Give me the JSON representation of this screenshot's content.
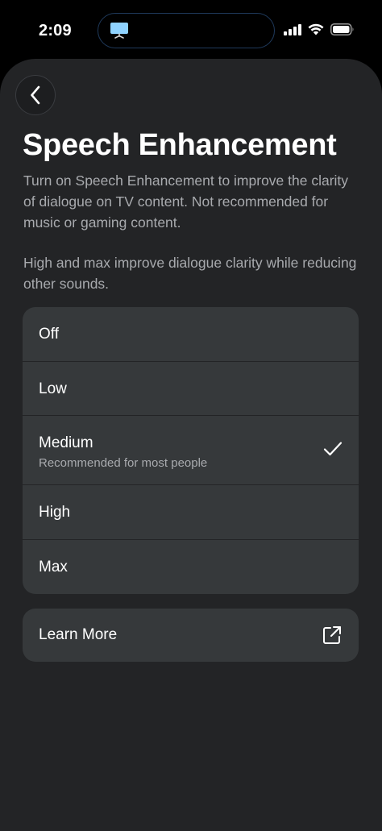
{
  "status_bar": {
    "time": "2:09"
  },
  "page": {
    "title": "Speech Enhancement",
    "description_1": "Turn on Speech Enhancement to improve the clarity of dialogue on TV content. Not recommended for music or gaming content.",
    "description_2": "High and max improve dialogue clarity while reducing other sounds."
  },
  "options": [
    {
      "label": "Off"
    },
    {
      "label": "Low"
    },
    {
      "label": "Medium",
      "sublabel": "Recommended for most people",
      "selected": true
    },
    {
      "label": "High"
    },
    {
      "label": "Max"
    }
  ],
  "learn_more": {
    "label": "Learn More",
    "icon": "external-link-icon"
  },
  "colors": {
    "sheet_background": "#232426",
    "card_background": "#36393b",
    "secondary_text": "#a8aaae"
  }
}
